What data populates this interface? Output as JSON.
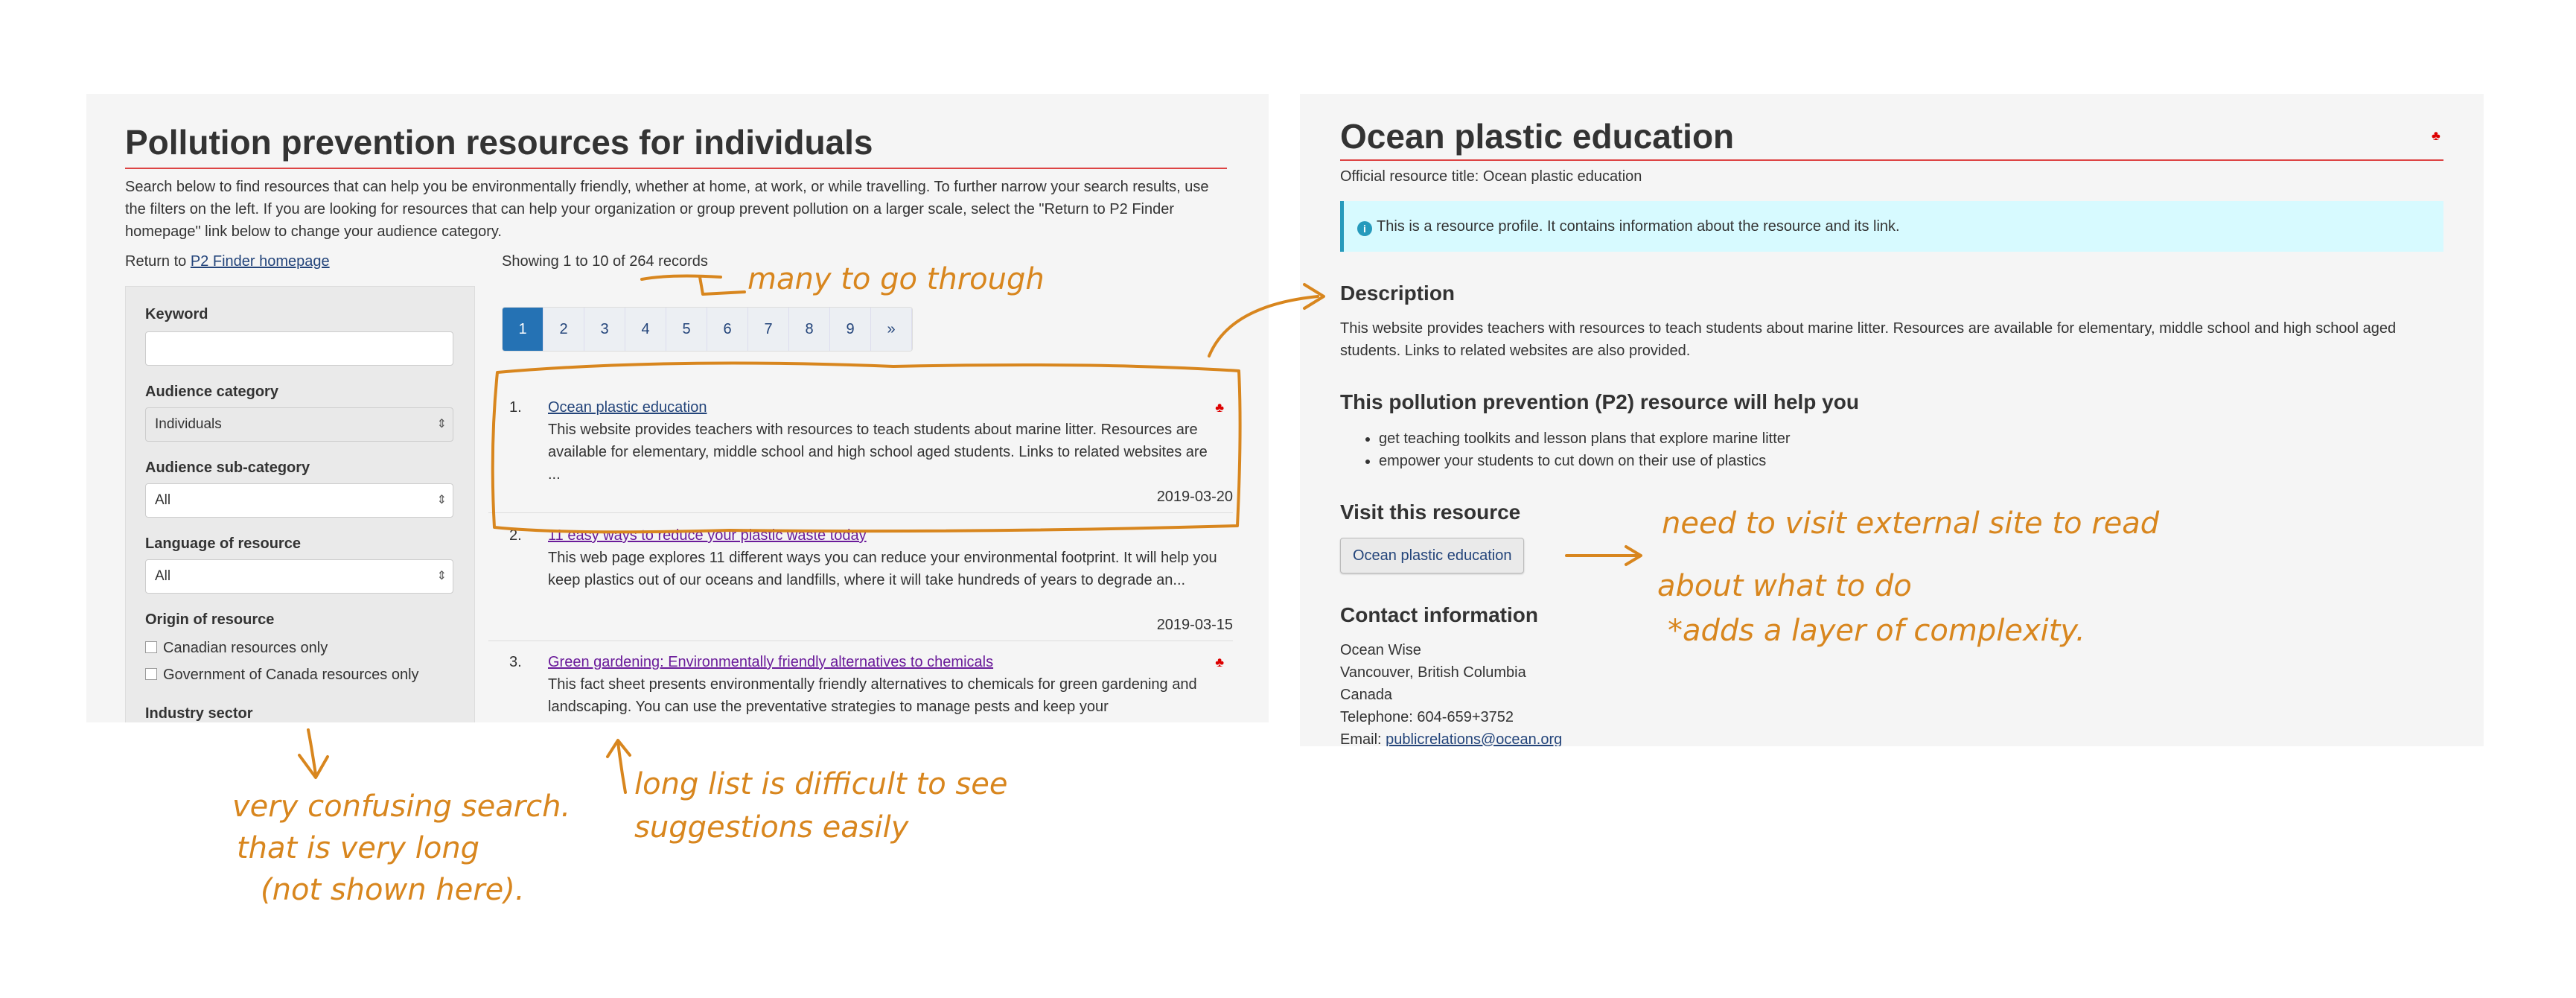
{
  "left": {
    "title": "Pollution prevention resources for individuals",
    "intro": "Search below to find resources that can help you be environmentally friendly, whether at home, at work, or while travelling. To further narrow your search results, use the filters on the left. If you are looking for resources that can help your organization or group prevent pollution on a larger scale, select the \"Return to P2 Finder homepage\" link below to change your audience category.",
    "return_prefix": "Return to ",
    "return_link": "P2 Finder homepage",
    "filters": {
      "keyword_label": "Keyword",
      "keyword_value": "",
      "audience_category_label": "Audience category",
      "audience_category_value": "Individuals",
      "audience_sub_label": "Audience sub-category",
      "audience_sub_value": "All",
      "language_label": "Language of resource",
      "language_value": "All",
      "origin_label": "Origin of resource",
      "origin_options": [
        "Canadian resources only",
        "Government of Canada resources only"
      ],
      "industry_label": "Industry sector"
    },
    "showing": "Showing 1 to 10 of 264 records",
    "pages": [
      "1",
      "2",
      "3",
      "4",
      "5",
      "6",
      "7",
      "8",
      "9",
      "»"
    ],
    "active_page": "1",
    "results": [
      {
        "num": "1.",
        "title": "Ocean plastic education",
        "desc": "This website provides teachers with resources to teach students about marine litter. Resources are available for elementary, middle school and high school aged students. Links to related websites are ...",
        "date": "2019-03-20",
        "canadian": true
      },
      {
        "num": "2.",
        "title": "11 easy ways to reduce your plastic waste today",
        "desc": "This web page explores 11 different ways you can reduce your environmental footprint. It will help you keep plastics out of our oceans and landfills, where it will take hundreds of years to degrade an...",
        "date": "2019-03-15",
        "canadian": false
      },
      {
        "num": "3.",
        "title": "Green gardening: Environmentally friendly alternatives to chemicals",
        "desc": "This fact sheet presents environmentally friendly alternatives to chemicals for green gardening and landscaping. You can use the preventative strategies to manage pests and keep your",
        "date": "",
        "canadian": true
      }
    ]
  },
  "right": {
    "title": "Ocean plastic education",
    "official": "Official resource title: Ocean plastic education",
    "alert": "This is a resource profile. It contains information about the resource and its link.",
    "description_heading": "Description",
    "description": "This website provides teachers with resources to teach students about marine litter. Resources are available for elementary, middle school and high school aged students. Links to related websites are also provided.",
    "help_heading": "This pollution prevention (P2) resource will help you",
    "help_items": [
      "get teaching toolkits and lesson plans that explore marine litter",
      "empower your students to cut down on their use of plastics"
    ],
    "visit_heading": "Visit this resource",
    "visit_button": "Ocean plastic education",
    "contact_heading": "Contact information",
    "contact": {
      "name": "Ocean Wise",
      "city": "Vancouver, British Columbia",
      "country": "Canada",
      "telephone": "Telephone: 604-659+3752",
      "email_prefix": "Email: ",
      "email": "publicrelations@ocean.org"
    }
  },
  "annotations": {
    "too_many": "many to go through",
    "external": [
      "need to visit external site to read",
      "about what to do",
      "*adds a layer of complexity."
    ],
    "search": [
      "very confusing search.",
      "that is very long",
      "(not shown here)."
    ],
    "list": [
      "long list is difficult to see",
      "suggestions easily"
    ]
  },
  "colors": {
    "accent": "#2572b4",
    "rule": "#dd4444",
    "alert_bg": "#d7faff",
    "annotation": "#d8861e"
  }
}
